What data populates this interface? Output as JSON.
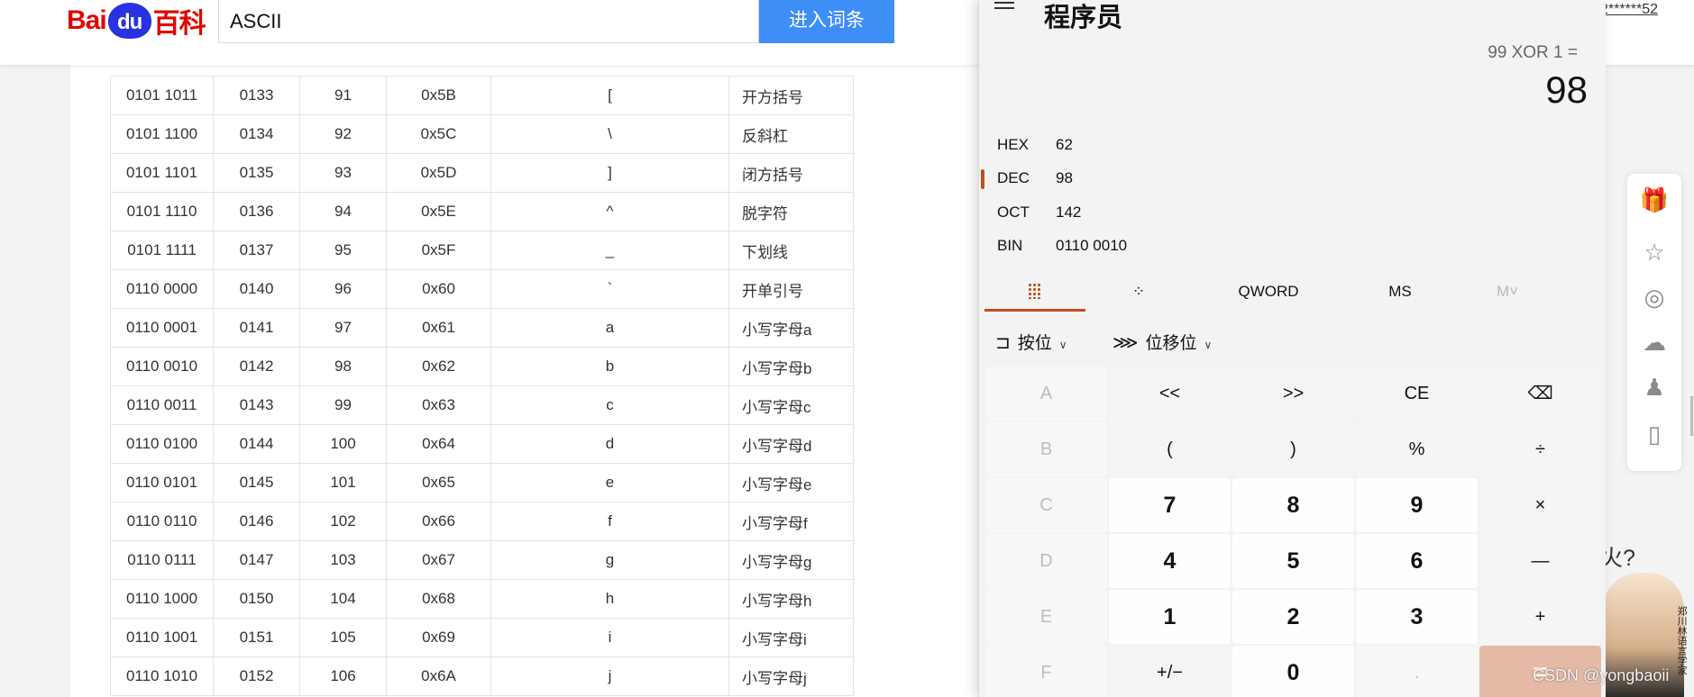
{
  "baidu": {
    "logo_left": "Bai",
    "logo_paw": "du",
    "logo_right": "百科",
    "search_value": "ASCII",
    "search_button": "进入词条",
    "user_link": "2******52"
  },
  "ascii_rows": [
    [
      "0101 1011",
      "0133",
      "91",
      "0x5B",
      "[",
      "开方括号"
    ],
    [
      "0101 1100",
      "0134",
      "92",
      "0x5C",
      "\\",
      "反斜杠"
    ],
    [
      "0101 1101",
      "0135",
      "93",
      "0x5D",
      "]",
      "闭方括号"
    ],
    [
      "0101 1110",
      "0136",
      "94",
      "0x5E",
      "^",
      "脱字符"
    ],
    [
      "0101 1111",
      "0137",
      "95",
      "0x5F",
      "_",
      "下划线"
    ],
    [
      "0110 0000",
      "0140",
      "96",
      "0x60",
      "`",
      "开单引号"
    ],
    [
      "0110 0001",
      "0141",
      "97",
      "0x61",
      "a",
      "小写字母a"
    ],
    [
      "0110 0010",
      "0142",
      "98",
      "0x62",
      "b",
      "小写字母b"
    ],
    [
      "0110 0011",
      "0143",
      "99",
      "0x63",
      "c",
      "小写字母c"
    ],
    [
      "0110 0100",
      "0144",
      "100",
      "0x64",
      "d",
      "小写字母d"
    ],
    [
      "0110 0101",
      "0145",
      "101",
      "0x65",
      "e",
      "小写字母e"
    ],
    [
      "0110 0110",
      "0146",
      "102",
      "0x66",
      "f",
      "小写字母f"
    ],
    [
      "0110 0111",
      "0147",
      "103",
      "0x67",
      "g",
      "小写字母g"
    ],
    [
      "0110 1000",
      "0150",
      "104",
      "0x68",
      "h",
      "小写字母h"
    ],
    [
      "0110 1001",
      "0151",
      "105",
      "0x69",
      "i",
      "小写字母i"
    ],
    [
      "0110 1010",
      "0152",
      "106",
      "0x6A",
      "j",
      "小写字母j"
    ]
  ],
  "calc": {
    "title": "程序员",
    "expression": "99 XOR 1 =",
    "result": "98",
    "radix": {
      "hex_label": "HEX",
      "hex_value": "62",
      "dec_label": "DEC",
      "dec_value": "98",
      "oct_label": "OCT",
      "oct_value": "142",
      "bin_label": "BIN",
      "bin_value": "0110 0010"
    },
    "tabs": {
      "word_size": "QWORD",
      "ms": "MS",
      "mv": "M˅"
    },
    "bitwise_label": "按位",
    "bitshift_label": "位移位",
    "keys": {
      "A": "A",
      "lsh": "<<",
      "rsh": ">>",
      "ce": "CE",
      "back": "⌫",
      "B": "B",
      "lparen": "(",
      "rparen": ")",
      "mod": "%",
      "div": "÷",
      "C": "C",
      "k7": "7",
      "k8": "8",
      "k9": "9",
      "mul": "×",
      "D": "D",
      "k4": "4",
      "k5": "5",
      "k6": "6",
      "sub": "—",
      "E": "E",
      "k1": "1",
      "k2": "2",
      "k3": "3",
      "add": "+",
      "F": "F",
      "negate": "+/−",
      "k0": "0",
      "dot": ".",
      "eq": "="
    },
    "accent_color": "#c14f1c"
  },
  "sidebar_icons": [
    "gift-icon",
    "star-icon",
    "weibo-icon",
    "wechat-icon",
    "qq-icon",
    "mobile-icon"
  ],
  "ad": {
    "text": "火?",
    "caption": "郑川林语言学家"
  },
  "watermark": "CSDN @yongbaoii"
}
